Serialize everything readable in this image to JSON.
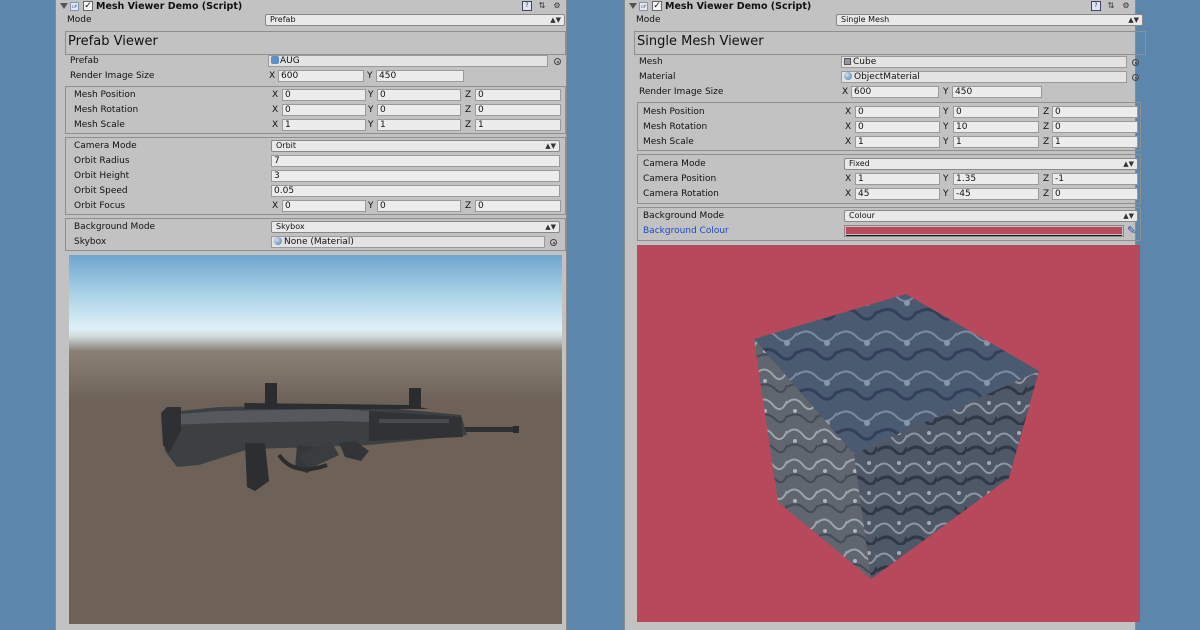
{
  "left": {
    "script_title": "Mesh Viewer Demo (Script)",
    "mode_label": "Mode",
    "mode_value": "Prefab",
    "viewer_title": "Prefab Viewer",
    "prefab_label": "Prefab",
    "prefab_value": "AUG",
    "render_size_label": "Render Image Size",
    "render_x": "600",
    "render_y": "450",
    "mesh_position_label": "Mesh Position",
    "mesh_position": [
      "0",
      "0",
      "0"
    ],
    "mesh_rotation_label": "Mesh Rotation",
    "mesh_rotation": [
      "0",
      "0",
      "0"
    ],
    "mesh_scale_label": "Mesh Scale",
    "mesh_scale": [
      "1",
      "1",
      "1"
    ],
    "camera_mode_label": "Camera Mode",
    "camera_mode_value": "Orbit",
    "orbit_radius_label": "Orbit Radius",
    "orbit_radius": "7",
    "orbit_height_label": "Orbit Height",
    "orbit_height": "3",
    "orbit_speed_label": "Orbit Speed",
    "orbit_speed": "0.05",
    "orbit_focus_label": "Orbit Focus",
    "orbit_focus": [
      "0",
      "0",
      "0"
    ],
    "background_mode_label": "Background Mode",
    "background_mode_value": "Skybox",
    "skybox_label": "Skybox",
    "skybox_value": "None (Material)"
  },
  "right": {
    "script_title": "Mesh Viewer Demo (Script)",
    "mode_label": "Mode",
    "mode_value": "Single Mesh",
    "viewer_title": "Single Mesh Viewer",
    "mesh_label": "Mesh",
    "mesh_value": "Cube",
    "material_label": "Material",
    "material_value": "ObjectMaterial",
    "render_size_label": "Render Image Size",
    "render_x": "600",
    "render_y": "450",
    "mesh_position_label": "Mesh Position",
    "mesh_position": [
      "0",
      "0",
      "0"
    ],
    "mesh_rotation_label": "Mesh Rotation",
    "mesh_rotation": [
      "0",
      "10",
      "0"
    ],
    "mesh_scale_label": "Mesh Scale",
    "mesh_scale": [
      "1",
      "1",
      "1"
    ],
    "camera_mode_label": "Camera Mode",
    "camera_mode_value": "Fixed",
    "camera_position_label": "Camera Position",
    "camera_position": [
      "1",
      "1.35",
      "-1"
    ],
    "camera_rotation_label": "Camera Rotation",
    "camera_rotation": [
      "45",
      "-45",
      "0"
    ],
    "background_mode_label": "Background Mode",
    "background_mode_value": "Colour",
    "background_colour_label": "Background Colour",
    "background_colour": "#b8485c"
  },
  "axis_labels": {
    "x": "X",
    "y": "Y",
    "z": "Z"
  },
  "icons": {
    "fold": "foldout-arrow-icon",
    "script": "cs-script-icon",
    "enabled": "enabled-checkbox",
    "book": "help-book-icon",
    "settings": "presets-icon",
    "gear": "gear-icon"
  },
  "colors": {
    "page_background": "#5d86ad",
    "inspector_background": "#c2c2c2",
    "prefab_ground": "#6e6258",
    "prefab_sky": "#dff0f7"
  }
}
